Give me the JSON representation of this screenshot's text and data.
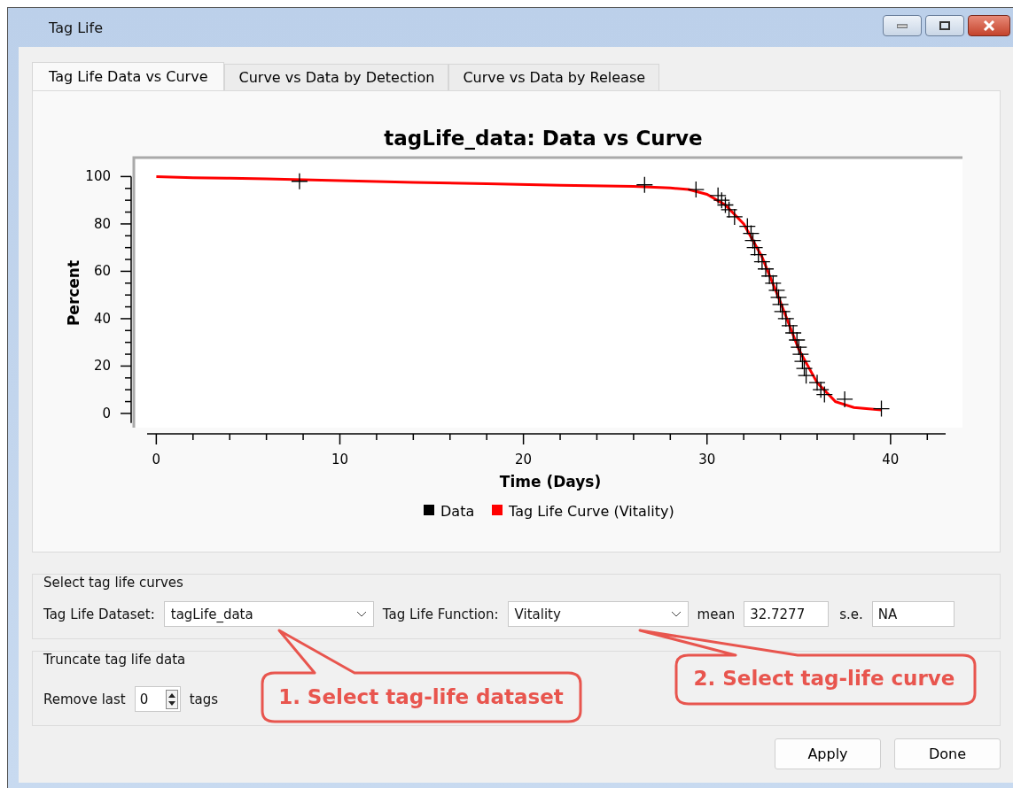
{
  "window": {
    "title": "Tag Life"
  },
  "tabs": [
    {
      "label": "Tag Life Data vs Curve",
      "selected": true
    },
    {
      "label": "Curve vs Data by Detection",
      "selected": false
    },
    {
      "label": "Curve vs Data by Release",
      "selected": false
    }
  ],
  "chart": {
    "chart_data": {
      "type": "scatter",
      "title": "tagLife_data: Data vs Curve",
      "xlabel": "Time (Days)",
      "ylabel": "Percent",
      "legend": "bottom",
      "xlim": [
        -0.5,
        43
      ],
      "ylim": [
        -6,
        108
      ],
      "xticks": [
        0,
        10,
        20,
        30,
        40
      ],
      "yticks": [
        0,
        20,
        40,
        60,
        80,
        100
      ],
      "series": [
        {
          "name": "Tag Life Curve (Vitality)",
          "type": "line",
          "color": "#ff0000",
          "x": [
            0,
            2,
            4,
            6,
            10,
            14,
            18,
            22,
            26,
            28,
            29,
            30,
            31,
            32,
            33,
            34,
            35,
            36,
            37,
            38,
            39.5
          ],
          "values": [
            100,
            99.5,
            99.3,
            99,
            98.3,
            97.5,
            97,
            96.3,
            95.8,
            95.2,
            94.5,
            92.5,
            88,
            80,
            66,
            47,
            27,
            13,
            5,
            2.5,
            1.5
          ]
        },
        {
          "name": "Data",
          "marker": "cross",
          "color": "#000000",
          "x": [
            7.8,
            26.6,
            29.4,
            30.6,
            30.8,
            31,
            31.2,
            31.5,
            32.2,
            32.4,
            32.5,
            32.6,
            32.8,
            33,
            33.2,
            33.4,
            33.6,
            33.8,
            33.9,
            34,
            34.1,
            34.3,
            34.5,
            34.7,
            34.9,
            35,
            35.1,
            35.2,
            35.3,
            35.4,
            36,
            36.2,
            36.4,
            37.5,
            39.5
          ],
          "values": [
            98,
            96.5,
            94.5,
            92,
            90,
            88,
            86,
            83,
            79,
            76,
            73,
            70,
            67,
            64,
            61,
            58,
            55,
            52,
            49,
            46,
            43,
            40,
            37,
            34,
            31,
            28,
            25,
            22,
            19,
            16,
            13,
            10,
            8,
            6,
            2
          ]
        }
      ]
    }
  },
  "select_curves": {
    "title": "Select tag life curves",
    "dataset_label": "Tag Life Dataset:",
    "dataset": "tagLife_data",
    "function_label": "Tag Life Function:",
    "function": "Vitality",
    "mean_label": "mean",
    "mean": "32.7277",
    "se_label": "s.e.",
    "se": "NA"
  },
  "truncate": {
    "title": "Truncate tag life data",
    "remove_label": "Remove last",
    "count": "0",
    "unit": "tags"
  },
  "callouts": [
    {
      "text": "1. Select tag-life dataset"
    },
    {
      "text": "2. Select tag-life curve"
    }
  ],
  "buttons": [
    "Apply",
    "Done"
  ]
}
